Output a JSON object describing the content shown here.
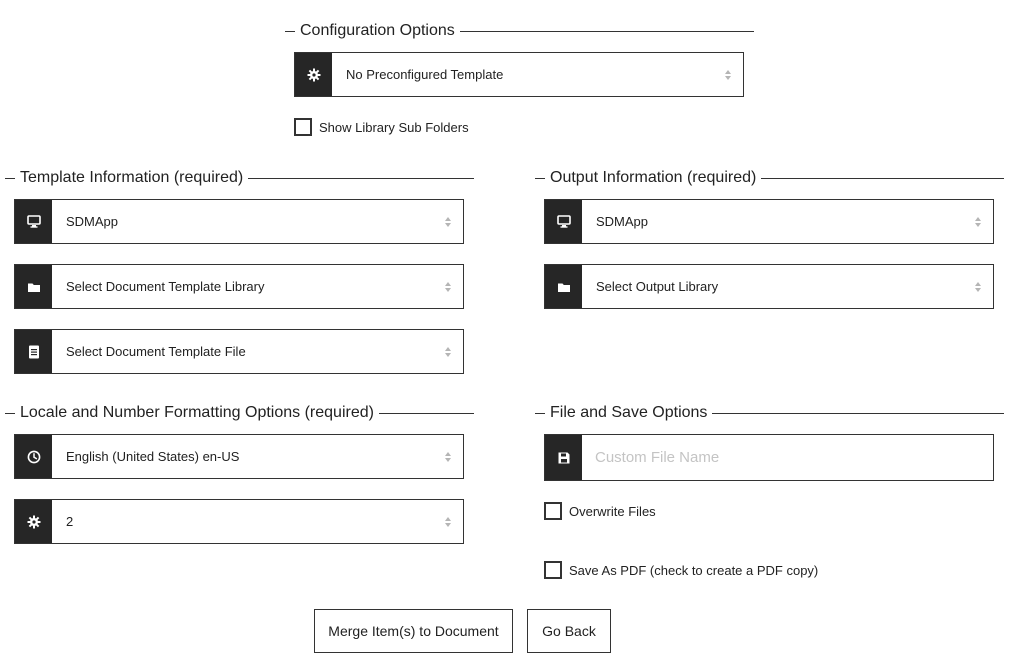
{
  "config": {
    "title": "Configuration Options",
    "template_select": {
      "icon": "gear-icon",
      "value": "No Preconfigured Template"
    },
    "show_subfolders_label": "Show Library Sub Folders"
  },
  "template_info": {
    "title": "Template Information (required)",
    "site": {
      "icon": "monitor-icon",
      "value": "SDMApp"
    },
    "library": {
      "icon": "folder-icon",
      "value": "Select Document Template Library"
    },
    "file": {
      "icon": "document-icon",
      "value": "Select Document Template File"
    }
  },
  "output_info": {
    "title": "Output Information (required)",
    "site": {
      "icon": "monitor-icon",
      "value": "SDMApp"
    },
    "library": {
      "icon": "folder-icon",
      "value": "Select Output Library"
    }
  },
  "locale": {
    "title": "Locale and Number Formatting Options (required)",
    "locale_select": {
      "icon": "clock-icon",
      "value": "English (United States) en-US"
    },
    "decimals_select": {
      "icon": "gear-icon",
      "value": "2"
    }
  },
  "file_save": {
    "title": "File and Save Options",
    "file_name": {
      "icon": "save-icon",
      "placeholder": "Custom File Name",
      "value": ""
    },
    "overwrite_label": "Overwrite Files",
    "pdf_label": "Save As PDF (check to create a PDF copy)"
  },
  "actions": {
    "merge_label": "Merge Item(s) to Document",
    "back_label": "Go Back"
  },
  "colors": {
    "icon_bg": "#262626",
    "border": "#333333",
    "placeholder": "#c4c4c4"
  }
}
